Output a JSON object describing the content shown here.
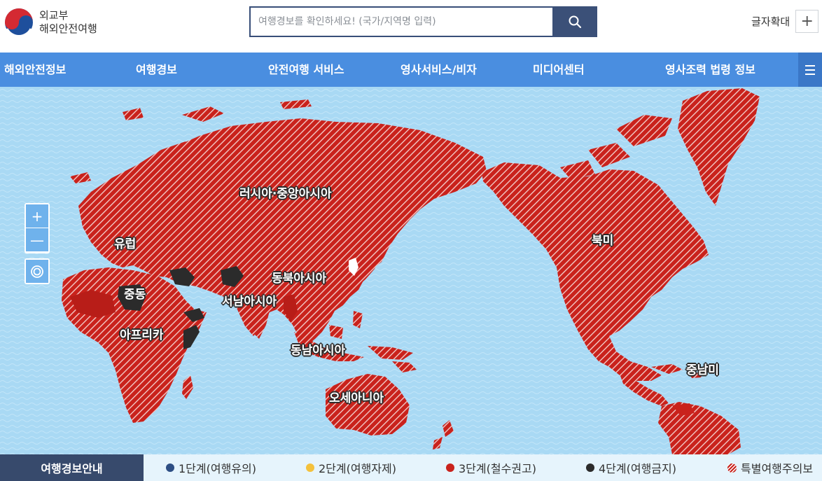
{
  "header": {
    "logo_line1": "외교부",
    "logo_line2": "해외안전여행",
    "search_placeholder": "여행경보를 확인하세요! (국가/지역명 입력)",
    "font_size_label": "글자확대",
    "font_size_button": "+"
  },
  "nav": {
    "items": [
      "해외안전정보",
      "여행경보",
      "안전여행 서비스",
      "영사서비스/비자",
      "미디어센터",
      "영사조력 법령 정보"
    ]
  },
  "map": {
    "zoom_in": "+",
    "zoom_out": "—",
    "regions": [
      "러시아·중앙아시아",
      "유럽",
      "중동",
      "아프리카",
      "서남아시아",
      "동북아시아",
      "동남아시아",
      "오세아니아",
      "북미",
      "중남미"
    ]
  },
  "legend": {
    "title": "여행경보안내",
    "items": [
      {
        "label": "1단계(여행유의)",
        "color": "#2d4e84"
      },
      {
        "label": "2단계(여행자제)",
        "color": "#f4c13c"
      },
      {
        "label": "3단계(철수권고)",
        "color": "#c9221c"
      },
      {
        "label": "4단계(여행금지)",
        "color": "#2b2b2b"
      },
      {
        "label": "특별여행주의보",
        "color": "#c9221c"
      }
    ]
  },
  "colors": {
    "nav_bg": "#4a8ee0",
    "ocean": "#a9d9f4",
    "level3": "#c9221c",
    "level4": "#2b2b2b",
    "legend_title_bg": "#374a6c"
  }
}
